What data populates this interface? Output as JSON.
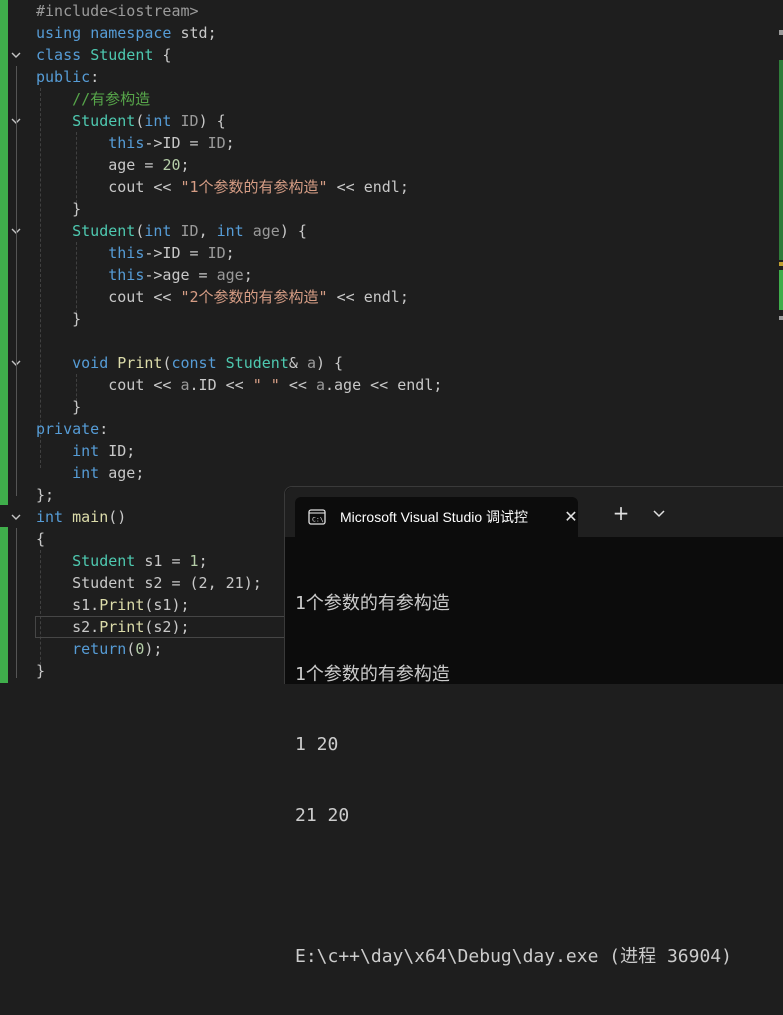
{
  "editor": {
    "lines": [
      {
        "parts": [
          [
            "pp",
            "#include<iostream>"
          ]
        ]
      },
      {
        "parts": [
          [
            "k",
            "using"
          ],
          [
            "m",
            " "
          ],
          [
            "k",
            "namespace"
          ],
          [
            "m",
            " std;"
          ]
        ]
      },
      {
        "parts": [
          [
            "k",
            "class"
          ],
          [
            "m",
            " "
          ],
          [
            "t",
            "Student"
          ],
          [
            "m",
            " {"
          ]
        ]
      },
      {
        "parts": [
          [
            "k",
            "public"
          ],
          [
            "m",
            ":"
          ]
        ]
      },
      {
        "parts": [
          [
            "m",
            "    "
          ],
          [
            "c",
            "//有参构造"
          ]
        ]
      },
      {
        "parts": [
          [
            "m",
            "    "
          ],
          [
            "t",
            "Student"
          ],
          [
            "m",
            "("
          ],
          [
            "k",
            "int"
          ],
          [
            "m",
            " "
          ],
          [
            "p",
            "ID"
          ],
          [
            "m",
            ") {"
          ]
        ]
      },
      {
        "parts": [
          [
            "m",
            "        "
          ],
          [
            "k",
            "this"
          ],
          [
            "m",
            "->ID = "
          ],
          [
            "p",
            "ID"
          ],
          [
            "m",
            ";"
          ]
        ]
      },
      {
        "parts": [
          [
            "m",
            "        age = "
          ],
          [
            "n",
            "20"
          ],
          [
            "m",
            ";"
          ]
        ]
      },
      {
        "parts": [
          [
            "m",
            "        cout << "
          ],
          [
            "s",
            "\"1个参数的有参构造\""
          ],
          [
            "m",
            " << endl;"
          ]
        ]
      },
      {
        "parts": [
          [
            "m",
            "    }"
          ]
        ]
      },
      {
        "parts": [
          [
            "m",
            "    "
          ],
          [
            "t",
            "Student"
          ],
          [
            "m",
            "("
          ],
          [
            "k",
            "int"
          ],
          [
            "m",
            " "
          ],
          [
            "p",
            "ID"
          ],
          [
            "m",
            ", "
          ],
          [
            "k",
            "int"
          ],
          [
            "m",
            " "
          ],
          [
            "p",
            "age"
          ],
          [
            "m",
            ") {"
          ]
        ]
      },
      {
        "parts": [
          [
            "m",
            "        "
          ],
          [
            "k",
            "this"
          ],
          [
            "m",
            "->ID = "
          ],
          [
            "p",
            "ID"
          ],
          [
            "m",
            ";"
          ]
        ]
      },
      {
        "parts": [
          [
            "m",
            "        "
          ],
          [
            "k",
            "this"
          ],
          [
            "m",
            "->age = "
          ],
          [
            "p",
            "age"
          ],
          [
            "m",
            ";"
          ]
        ]
      },
      {
        "parts": [
          [
            "m",
            "        cout << "
          ],
          [
            "s",
            "\"2个参数的有参构造\""
          ],
          [
            "m",
            " << endl;"
          ]
        ]
      },
      {
        "parts": [
          [
            "m",
            "    }"
          ]
        ]
      },
      {
        "parts": [
          [
            "m",
            ""
          ]
        ]
      },
      {
        "parts": [
          [
            "m",
            "    "
          ],
          [
            "k",
            "void"
          ],
          [
            "m",
            " "
          ],
          [
            "f",
            "Print"
          ],
          [
            "m",
            "("
          ],
          [
            "k",
            "const"
          ],
          [
            "m",
            " "
          ],
          [
            "t",
            "Student"
          ],
          [
            "m",
            "& "
          ],
          [
            "p",
            "a"
          ],
          [
            "m",
            ") {"
          ]
        ]
      },
      {
        "parts": [
          [
            "m",
            "        cout << "
          ],
          [
            "p",
            "a"
          ],
          [
            "m",
            ".ID << "
          ],
          [
            "s",
            "\" \""
          ],
          [
            "m",
            " << "
          ],
          [
            "p",
            "a"
          ],
          [
            "m",
            ".age << endl;"
          ]
        ]
      },
      {
        "parts": [
          [
            "m",
            "    }"
          ]
        ]
      },
      {
        "parts": [
          [
            "k",
            "private"
          ],
          [
            "m",
            ":"
          ]
        ]
      },
      {
        "parts": [
          [
            "m",
            "    "
          ],
          [
            "k",
            "int"
          ],
          [
            "m",
            " ID;"
          ]
        ]
      },
      {
        "parts": [
          [
            "m",
            "    "
          ],
          [
            "k",
            "int"
          ],
          [
            "m",
            " age;"
          ]
        ]
      },
      {
        "parts": [
          [
            "m",
            "};"
          ]
        ]
      },
      {
        "parts": [
          [
            "k",
            "int"
          ],
          [
            "m",
            " "
          ],
          [
            "f",
            "main"
          ],
          [
            "m",
            "()"
          ]
        ]
      },
      {
        "parts": [
          [
            "m",
            "{"
          ]
        ]
      },
      {
        "parts": [
          [
            "m",
            "    "
          ],
          [
            "t",
            "Student"
          ],
          [
            "m",
            " s1 = "
          ],
          [
            "n",
            "1"
          ],
          [
            "m",
            ";"
          ]
        ]
      },
      {
        "parts": [
          [
            "m",
            "    Student s2 = (2, 21);"
          ]
        ]
      },
      {
        "parts": [
          [
            "m",
            "    s1."
          ],
          [
            "f",
            "Print"
          ],
          [
            "m",
            "(s1);"
          ]
        ]
      },
      {
        "parts": [
          [
            "m",
            "    s2."
          ],
          [
            "f",
            "Print"
          ],
          [
            "m",
            "(s2);"
          ]
        ]
      },
      {
        "parts": [
          [
            "m",
            "    "
          ],
          [
            "k",
            "return"
          ],
          [
            "m",
            "("
          ],
          [
            "n",
            "0"
          ],
          [
            "m",
            ");"
          ]
        ]
      },
      {
        "parts": [
          [
            "m",
            "}"
          ]
        ]
      }
    ]
  },
  "terminal": {
    "tab_title": "Microsoft Visual Studio 调试控",
    "new_tab_symbol": "+",
    "close_symbol": "✕",
    "output_lines": [
      "1个参数的有参构造",
      "1个参数的有参构造",
      "1 20",
      "21 20",
      "",
      "E:\\c++\\day\\x64\\Debug\\day.exe (进程 36904)"
    ]
  }
}
